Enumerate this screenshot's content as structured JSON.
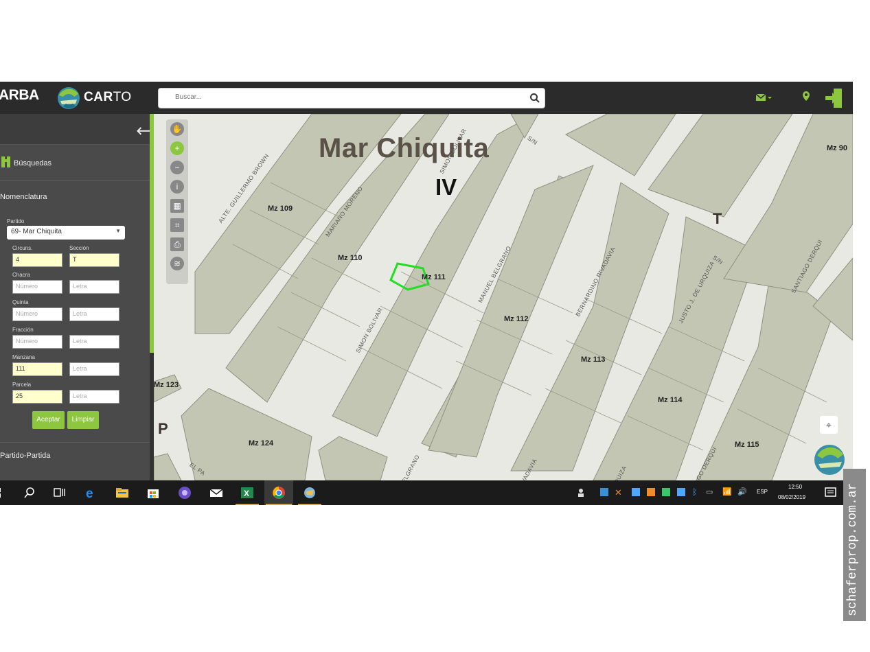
{
  "app": {
    "brand_arba": "ARBA",
    "brand_carto_a": "CAR",
    "brand_carto_b": "TO"
  },
  "search": {
    "placeholder": "Buscar..."
  },
  "sidebar": {
    "busquedas_label": "Búsquedas",
    "nomenclatura_label": "Nomenclatura",
    "partido_label": "Partido",
    "partido_value": "69- Mar Chiquita",
    "circuns_label": "Circuns.",
    "circuns_value": "4",
    "seccion_label": "Sección",
    "seccion_value": "T",
    "chacra_label": "Chacra",
    "chacra_num_placeholder": "Número",
    "chacra_letra_placeholder": "Letra",
    "quinta_label": "Quinta",
    "quinta_num_placeholder": "Número",
    "quinta_letra_placeholder": "Letra",
    "fraccion_label": "Fracción",
    "fraccion_num_placeholder": "Número",
    "fraccion_letra_placeholder": "Letra",
    "manzana_label": "Manzana",
    "manzana_value": "111",
    "manzana_letra_placeholder": "Letra",
    "parcela_label": "Parcela",
    "parcela_value": "25",
    "parcela_letra_placeholder": "Letra",
    "aceptar_label": "Aceptar",
    "limpiar_label": "Limpiar",
    "partido_partida_label": "Partido-Partida"
  },
  "map": {
    "title": "Mar Chiquita",
    "sector": "IV",
    "letter_t": "T",
    "letter_p": "P",
    "blocks": {
      "mz109": "Mz 109",
      "mz110": "Mz 110",
      "mz111": "Mz 111",
      "mz112": "Mz 112",
      "mz113": "Mz 113",
      "mz114": "Mz 114",
      "mz115": "Mz 115",
      "mz123": "Mz 123",
      "mz124": "Mz 124",
      "mz90": "Mz 90"
    },
    "streets": {
      "brown": "ALTE. GUILLERMO BROWN",
      "moreno": "MARIANO MORENO",
      "bolivar": "SIMON BOLIVAR",
      "bolivar_top": "SIMON BOLIVAR",
      "belgrano": "MANUEL BELGRANO",
      "belgrano_bottom": "BELGRANO",
      "rivadavia": "BERNARDINO RIVADAVIA",
      "rivadavia_bottom": "BERNARDINO RIVADAVIA",
      "urquiza": "JUSTO J. DE URQUIZA",
      "urquiza_bottom": "JUSTO J. DE URQUIZA",
      "derqui": "SANTIAGO DERQUI",
      "derqui_bottom": "SANTIAGO DERQUI",
      "sn1": "S/N",
      "sn2": "S/N",
      "el_pa": "EL PA"
    }
  },
  "taskbar": {
    "lang": "ESP",
    "time": "12:50",
    "date": "08/02/2019"
  },
  "watermark": "schaferprop.com.ar",
  "colors": {
    "accent_green": "#8dc63f",
    "topbar": "#2b2b2b",
    "sidebar": "#4a4a4a",
    "block_fill": "#c4c6b4",
    "selected_parcel": "#22dd22"
  }
}
